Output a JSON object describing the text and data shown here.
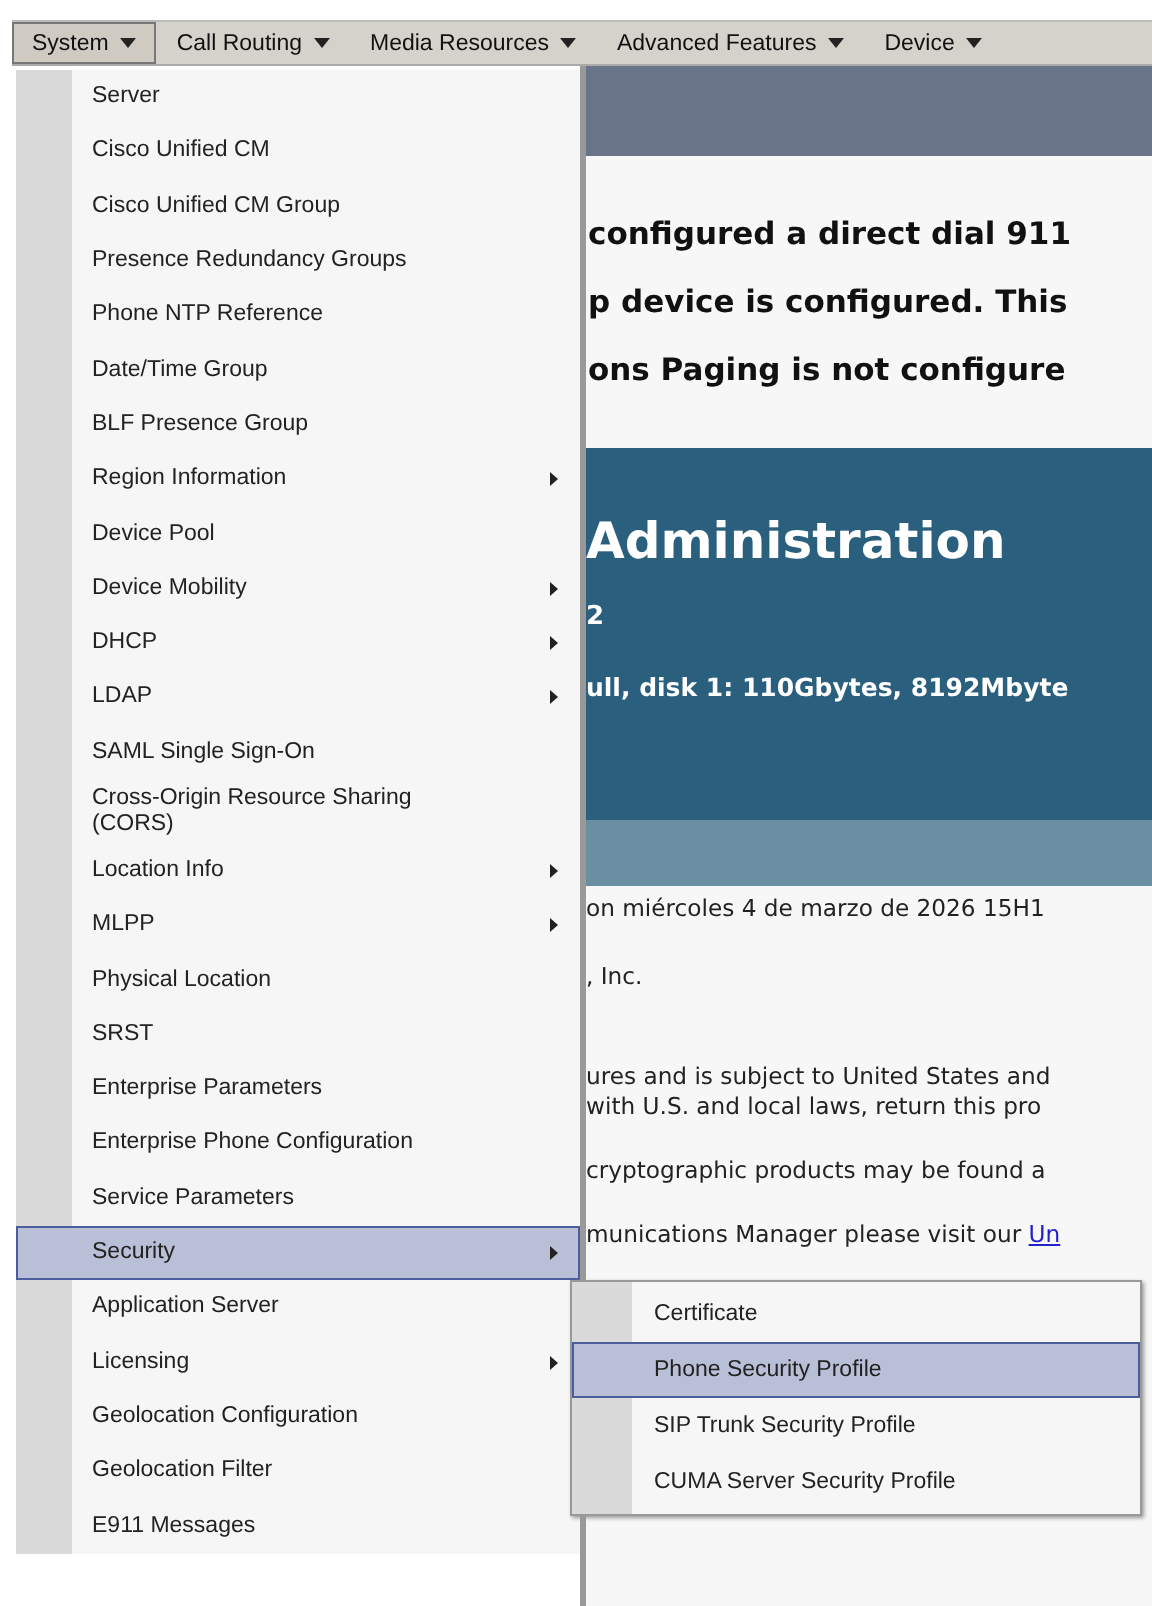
{
  "menubar": {
    "items": [
      {
        "label": "System",
        "selected": true
      },
      {
        "label": "Call Routing",
        "selected": false
      },
      {
        "label": "Media Resources",
        "selected": false
      },
      {
        "label": "Advanced Features",
        "selected": false
      },
      {
        "label": "Device",
        "selected": false
      }
    ]
  },
  "menu": {
    "items": [
      {
        "label": "Server",
        "submenu": false,
        "selected": false
      },
      {
        "label": "Cisco Unified CM",
        "submenu": false,
        "selected": false
      },
      {
        "label": "Cisco Unified CM Group",
        "submenu": false,
        "selected": false
      },
      {
        "label": "Presence Redundancy Groups",
        "submenu": false,
        "selected": false
      },
      {
        "label": "Phone NTP Reference",
        "submenu": false,
        "selected": false
      },
      {
        "label": "Date/Time Group",
        "submenu": false,
        "selected": false
      },
      {
        "label": "BLF Presence Group",
        "submenu": false,
        "selected": false
      },
      {
        "label": "Region Information",
        "submenu": true,
        "selected": false
      },
      {
        "label": "Device Pool",
        "submenu": false,
        "selected": false
      },
      {
        "label": "Device Mobility",
        "submenu": true,
        "selected": false
      },
      {
        "label": "DHCP",
        "submenu": true,
        "selected": false
      },
      {
        "label": "LDAP",
        "submenu": true,
        "selected": false
      },
      {
        "label": "SAML Single Sign-On",
        "submenu": false,
        "selected": false
      },
      {
        "label": "Cross-Origin Resource Sharing (CORS)",
        "submenu": false,
        "selected": false
      },
      {
        "label": "Location Info",
        "submenu": true,
        "selected": false
      },
      {
        "label": "MLPP",
        "submenu": true,
        "selected": false
      },
      {
        "label": "Physical Location",
        "submenu": false,
        "selected": false
      },
      {
        "label": "SRST",
        "submenu": false,
        "selected": false
      },
      {
        "label": "Enterprise Parameters",
        "submenu": false,
        "selected": false
      },
      {
        "label": "Enterprise Phone Configuration",
        "submenu": false,
        "selected": false
      },
      {
        "label": "Service Parameters",
        "submenu": false,
        "selected": false
      },
      {
        "label": "Security",
        "submenu": true,
        "selected": true
      },
      {
        "label": "Application Server",
        "submenu": false,
        "selected": false
      },
      {
        "label": "Licensing",
        "submenu": true,
        "selected": false
      },
      {
        "label": "Geolocation Configuration",
        "submenu": false,
        "selected": false
      },
      {
        "label": "Geolocation Filter",
        "submenu": false,
        "selected": false
      },
      {
        "label": "E911 Messages",
        "submenu": false,
        "selected": false
      }
    ]
  },
  "submenu": {
    "items": [
      {
        "label": "Certificate",
        "selected": false
      },
      {
        "label": "Phone Security Profile",
        "selected": true
      },
      {
        "label": "SIP Trunk Security Profile",
        "selected": false
      },
      {
        "label": "CUMA Server Security Profile",
        "selected": false
      }
    ]
  },
  "notices": [
    "configured a direct dial 911",
    "p device is configured. This",
    "ons Paging is not configure"
  ],
  "banner": {
    "title": "Administration",
    "version": "2",
    "hardware": "ull, disk 1: 110Gbytes, 8192Mbyte"
  },
  "body": {
    "login": "on miércoles 4 de marzo de 2026 15H1",
    "copyright": ", Inc.",
    "export_lines": [
      "ures and is subject to United States and",
      "with U.S. and local laws, return this pro"
    ],
    "crypto": "cryptographic products may be found a",
    "more_info": "munications Manager please visit our",
    "link": "Un"
  }
}
